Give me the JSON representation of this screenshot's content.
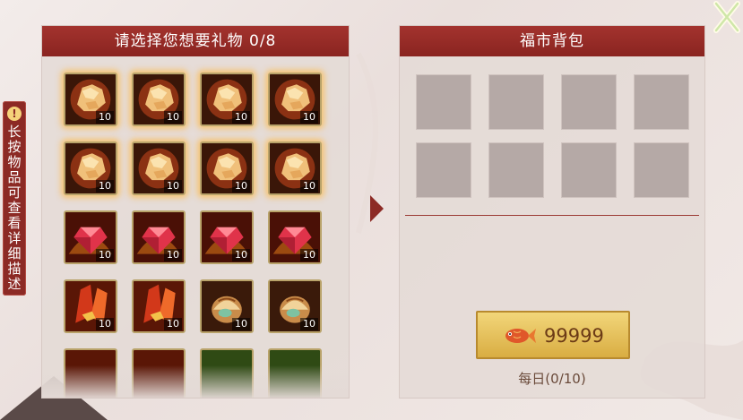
{
  "gift_panel": {
    "title": "请选择您想要礼物 0/8",
    "items": [
      {
        "icon": "gold-ore-icon",
        "count": "10"
      },
      {
        "icon": "gold-ore-icon",
        "count": "10"
      },
      {
        "icon": "gold-ore-icon",
        "count": "10"
      },
      {
        "icon": "gold-ore-icon",
        "count": "10"
      },
      {
        "icon": "gold-ore-icon",
        "count": "10"
      },
      {
        "icon": "gold-ore-icon",
        "count": "10"
      },
      {
        "icon": "gold-ore-icon",
        "count": "10"
      },
      {
        "icon": "gold-ore-icon",
        "count": "10"
      },
      {
        "icon": "red-gem-icon",
        "count": "10"
      },
      {
        "icon": "red-gem-icon",
        "count": "10"
      },
      {
        "icon": "red-gem-icon",
        "count": "10"
      },
      {
        "icon": "red-gem-icon",
        "count": "10"
      },
      {
        "icon": "red-crystal-icon",
        "count": "10"
      },
      {
        "icon": "red-crystal-icon",
        "count": "10"
      },
      {
        "icon": "shell-icon",
        "count": "10"
      },
      {
        "icon": "shell-icon",
        "count": "10"
      }
    ]
  },
  "side_tab": {
    "alert": "!",
    "text": "长按物品可查看详细描述"
  },
  "bag_panel": {
    "title": "福市背包",
    "price": "99999",
    "currency_icon": "koi-fish-icon",
    "daily_limit": "每日(0/10)"
  },
  "colors": {
    "header": "#8a2420",
    "accent_gold": "#d9ad42",
    "slot": "#b5a9a6"
  }
}
